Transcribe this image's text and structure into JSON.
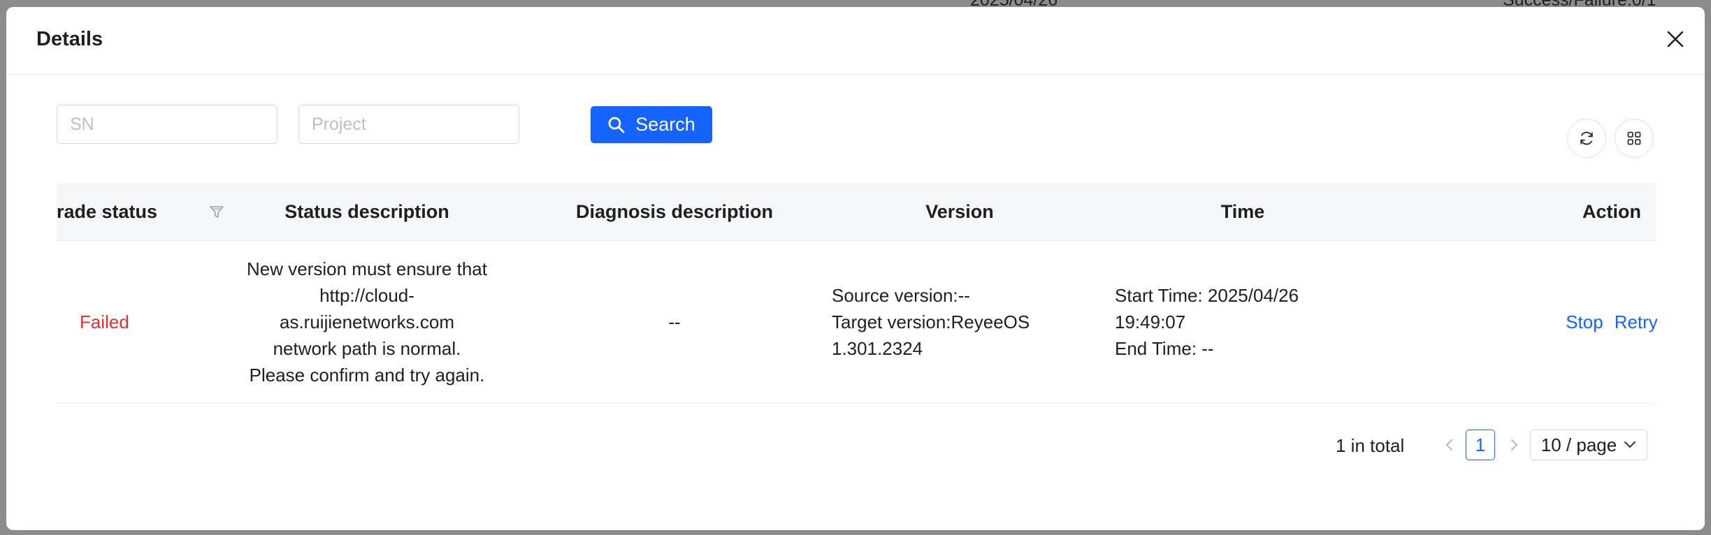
{
  "background": {
    "date_fragment": "2025/04/26",
    "result_fragment": "Success/Failure:0/1"
  },
  "modal": {
    "title": "Details",
    "close_icon": "close-icon"
  },
  "filters": {
    "sn_placeholder": "SN",
    "project_placeholder": "Project",
    "search_label": "Search",
    "search_icon": "search-icon"
  },
  "tools": {
    "refresh_icon": "refresh-icon",
    "columns_icon": "grid-icon"
  },
  "table": {
    "headers": {
      "upgrade_status": "rade status",
      "status_description": "Status description",
      "diagnosis_description": "Diagnosis description",
      "version": "Version",
      "time": "Time",
      "action": "Action"
    },
    "rows": [
      {
        "status": "Failed",
        "status_description": "New version must ensure that http://cloud-as.ruijienetworks.com network path is normal. Please confirm and try again.",
        "diagnosis_description": "--",
        "source_version": "Source version:--",
        "target_version": "Target version:ReyeeOS 1.301.2324",
        "start_time": "Start Time: 2025/04/26 19:49:07",
        "end_time": "End Time: --",
        "actions": [
          "Stop",
          "Retry"
        ]
      }
    ]
  },
  "pagination": {
    "total": "1 in total",
    "current_page": "1",
    "page_size": "10 / page"
  },
  "colors": {
    "primary": "#1664ff",
    "failed": "#e0302a"
  }
}
